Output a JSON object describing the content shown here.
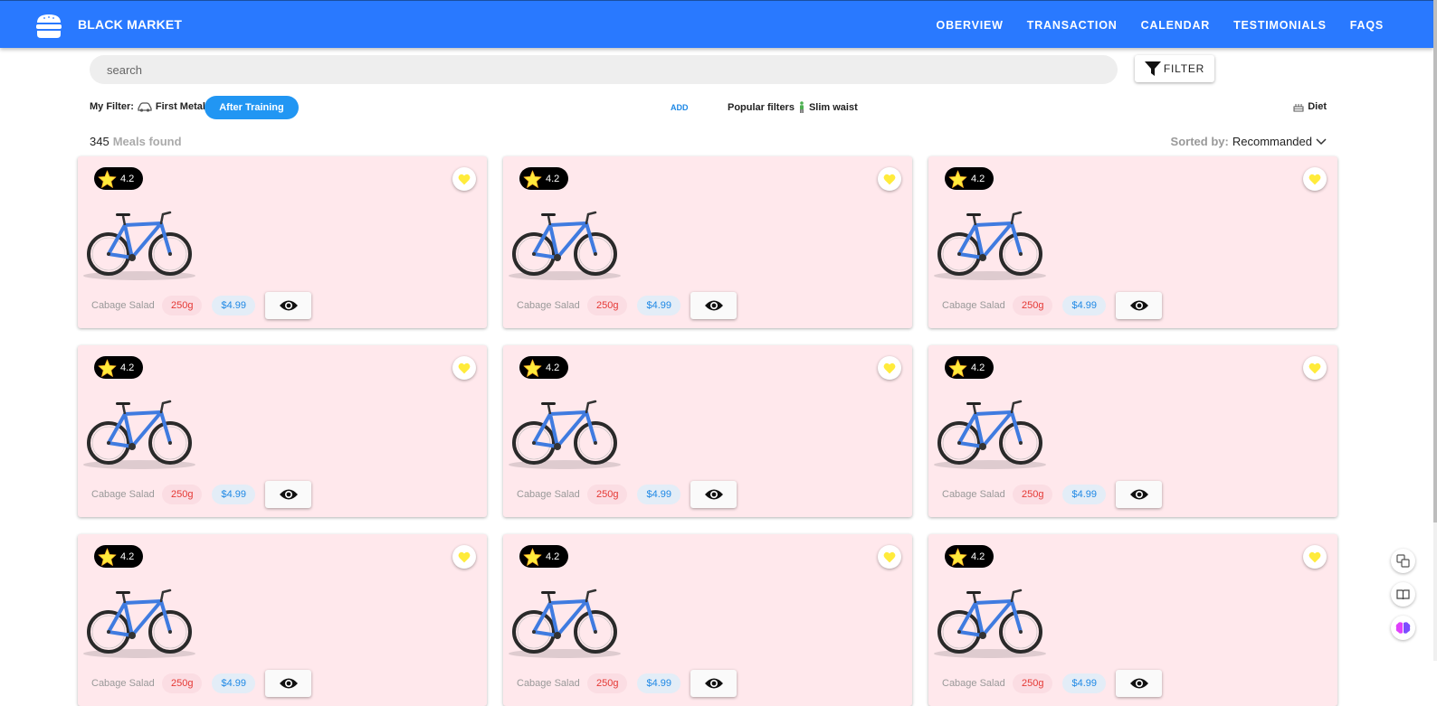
{
  "header": {
    "brand": "BLACK MARKET",
    "logo_icon": "burger-icon",
    "nav": [
      "OBERVIEW",
      "TRANSACTION",
      "CALENDAR",
      "TESTIMONIALS",
      "FAQS"
    ],
    "accent": "#2979ff"
  },
  "search": {
    "placeholder": "search",
    "value": ""
  },
  "filter_button": {
    "label": "FILTER",
    "icon": "funnel-icon"
  },
  "filters": {
    "my_filter_label": "My Filter:",
    "first_chip": "First Metal",
    "first_chip_icon": "car-icon",
    "active_chip": "After Training",
    "add_label": "ADD",
    "popular_label": "Popular filters",
    "popular_icon": "person-icon",
    "popular_chip": "Slim waist",
    "diet_label": "Diet",
    "diet_icon": "cake-icon"
  },
  "results": {
    "count": "345",
    "count_label": "Meals found",
    "sort_label": "Sorted by:",
    "sort_value": "Recommanded"
  },
  "cards": [
    {
      "rating": "4.2",
      "name": "Cabage Salad",
      "weight": "250g",
      "price": "$4.99"
    },
    {
      "rating": "4.2",
      "name": "Cabage Salad",
      "weight": "250g",
      "price": "$4.99"
    },
    {
      "rating": "4.2",
      "name": "Cabage Salad",
      "weight": "250g",
      "price": "$4.99"
    },
    {
      "rating": "4.2",
      "name": "Cabage Salad",
      "weight": "250g",
      "price": "$4.99"
    },
    {
      "rating": "4.2",
      "name": "Cabage Salad",
      "weight": "250g",
      "price": "$4.99"
    },
    {
      "rating": "4.2",
      "name": "Cabage Salad",
      "weight": "250g",
      "price": "$4.99"
    },
    {
      "rating": "4.2",
      "name": "Cabage Salad",
      "weight": "250g",
      "price": "$4.99"
    },
    {
      "rating": "4.2",
      "name": "Cabage Salad",
      "weight": "250g",
      "price": "$4.99"
    },
    {
      "rating": "4.2",
      "name": "Cabage Salad",
      "weight": "250g",
      "price": "$4.99"
    }
  ],
  "colors": {
    "card_bg": "#ffe8ec",
    "heart": "#ffeb3b",
    "star": "#ffeb3b",
    "weight_text": "#e53935",
    "price_text": "#1e88e5"
  }
}
